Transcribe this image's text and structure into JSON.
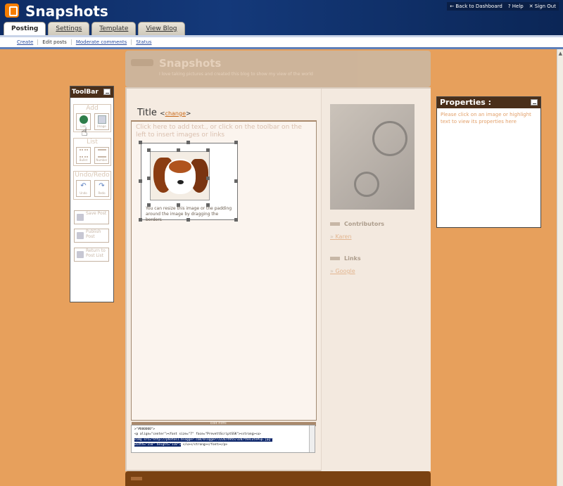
{
  "header": {
    "blog_title": "Snapshots",
    "links": [
      "← Back to Dashboard",
      "? Help",
      "✕ Sign Out"
    ]
  },
  "tabs": [
    "Posting",
    "Settings",
    "Template",
    "View Blog"
  ],
  "active_tab": "Posting",
  "subnav": [
    "Create",
    "Edit posts",
    "Moderate comments",
    "Status"
  ],
  "active_subnav": "Edit posts",
  "template": {
    "title": "Snapshots",
    "description": "I love taking pictures and created this blog to show my view of the world",
    "contributors_heading": "Contributors",
    "contributors": [
      "Karen"
    ],
    "links_heading": "Links",
    "links": [
      "Google"
    ]
  },
  "post": {
    "title_label": "Title",
    "change_link": "change",
    "editor_hint": "Click here to add text., or click on the toolbar on the left to insert images or links",
    "image_caption": "You can resize this image or the padding around the image by dragging the borders"
  },
  "html_editor": {
    "bar_label": "Edit html",
    "lines": [
      ">\"#000000\">",
      "<p align=\"center\"><font size=\"7\" face=\"PrevettScriptSSK\"><strong><u>",
      "<img src=\"http://photos1.blogger.com/blogger/2226/4955/320/theCutePup.jpg\"",
      "width=\"150\" height=\"110\">",
      "</u></strong></font></p>"
    ]
  },
  "toolbar": {
    "title": "ToolBar",
    "add_label": "Add",
    "add_buttons": [
      "Link",
      "Image"
    ],
    "list_label": "List",
    "list_buttons": [
      "Bullet",
      "Number"
    ],
    "undo_label": "Undo/Redo",
    "undo_buttons": [
      "Undo",
      "Redo"
    ],
    "save_post": "Save Post",
    "publish_post": "Publish Post",
    "return_label": "Return to Post List"
  },
  "properties": {
    "title": "Properties :",
    "hint": "Please click on an image or highlight text to view its properties here"
  }
}
